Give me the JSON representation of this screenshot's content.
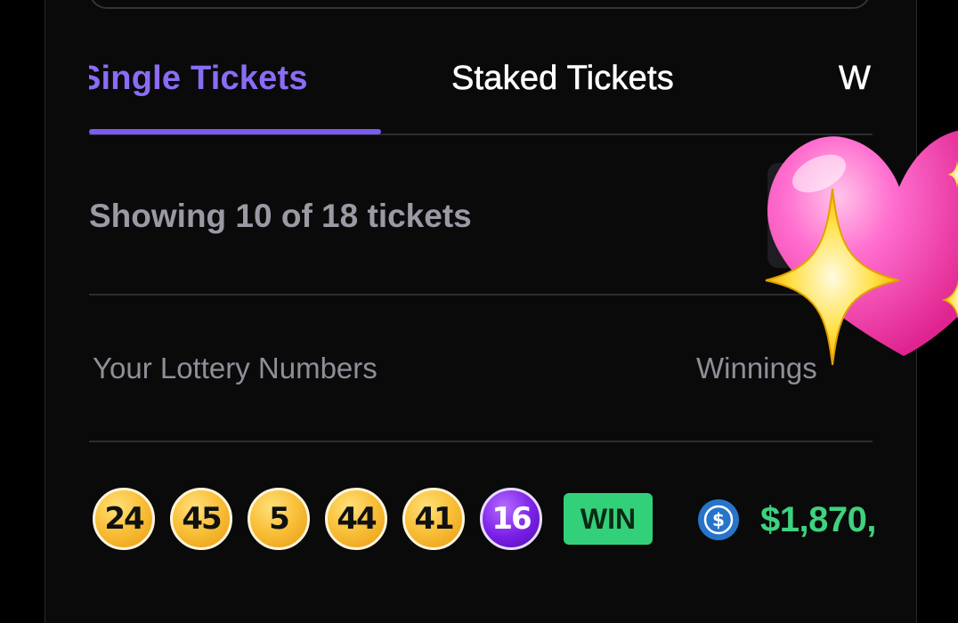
{
  "tabs": [
    {
      "label": "Single Tickets",
      "active": true
    },
    {
      "label": "Staked Tickets",
      "active": false
    },
    {
      "label": "W",
      "active": false
    }
  ],
  "summary": {
    "showing_text": "Showing 10 of 18 tickets"
  },
  "columns": {
    "numbers_header": "Your Lottery Numbers",
    "winnings_header": "Winnings"
  },
  "tickets": [
    {
      "numbers": [
        "24",
        "45",
        "5",
        "44",
        "41"
      ],
      "power_number": "16",
      "status": "WIN",
      "currency_icon": "usdc-coin-icon",
      "amount": "$1,870,"
    }
  ],
  "colors": {
    "accent": "#7b5cf0",
    "win": "#33d07a",
    "ball_gold": "#f9c13b",
    "ball_power": "#7a1fe6"
  },
  "overlay": {
    "sticker": "sparkling-heart-emoji"
  }
}
